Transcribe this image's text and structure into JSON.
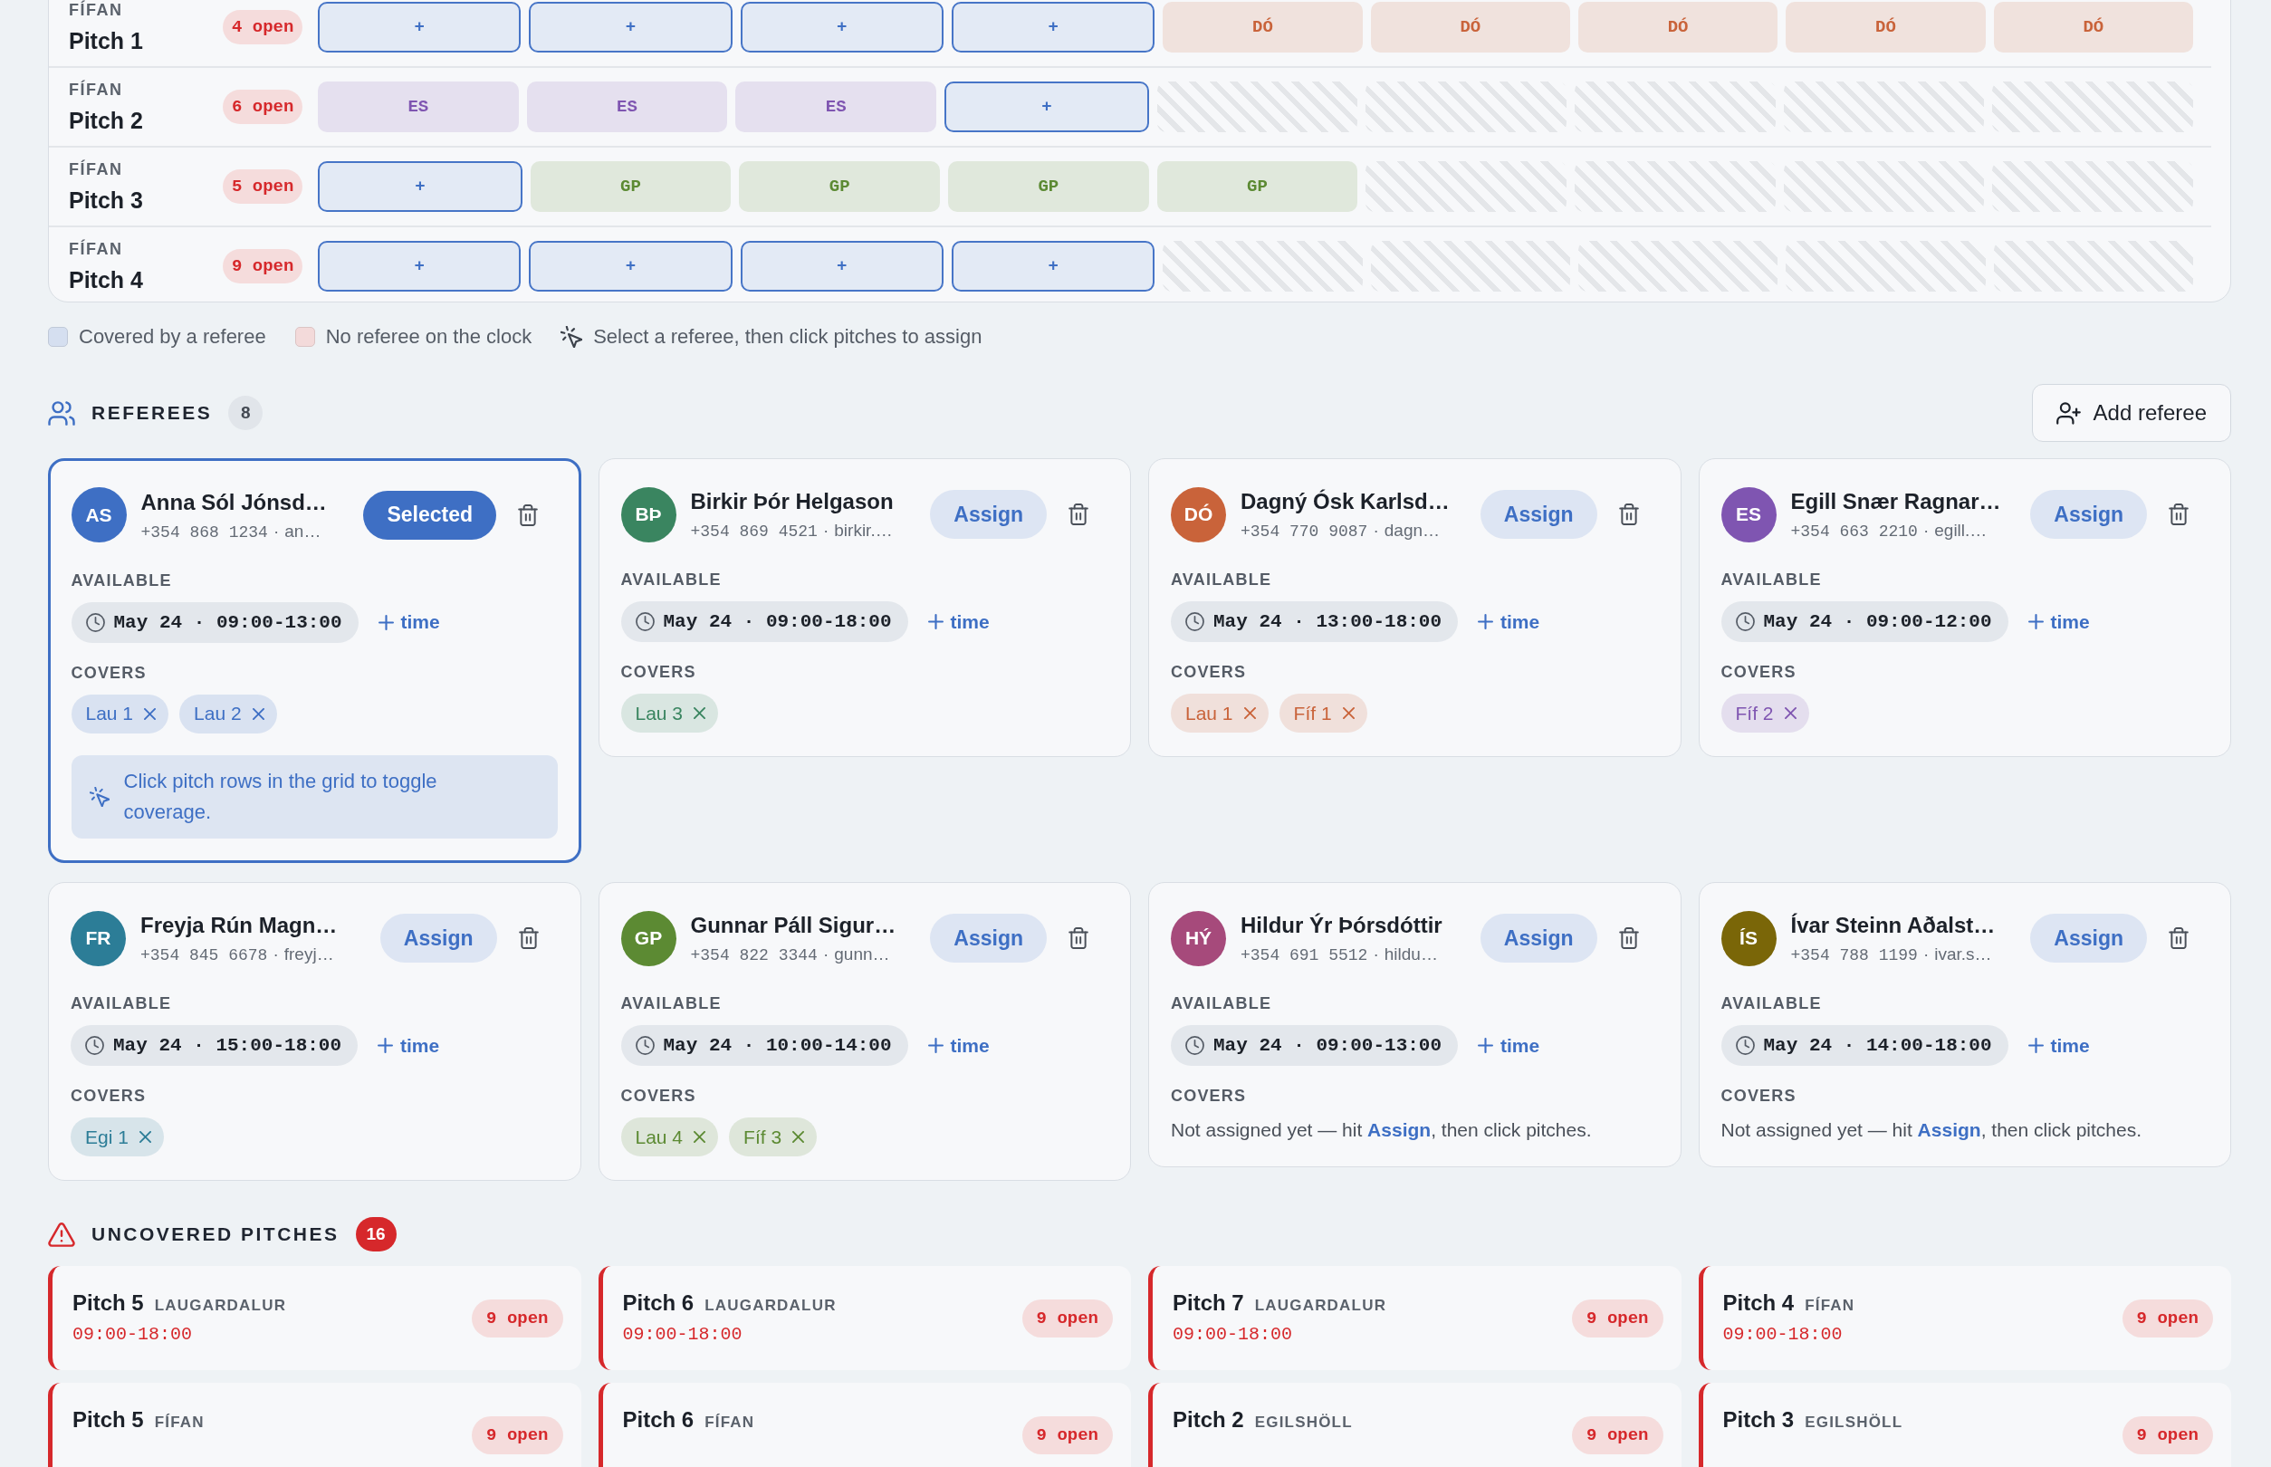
{
  "schedule_grid": {
    "rows": [
      {
        "venue": "FÍFAN",
        "pitch": "Pitch 1",
        "open": "4 open",
        "slots": [
          {
            "kind": "open",
            "label": "+"
          },
          {
            "kind": "open",
            "label": "+"
          },
          {
            "kind": "open",
            "label": "+"
          },
          {
            "kind": "open",
            "label": "+"
          },
          {
            "kind": "covered",
            "label": "DÓ",
            "color": "#c9633a"
          },
          {
            "kind": "covered",
            "label": "DÓ",
            "color": "#c9633a"
          },
          {
            "kind": "covered",
            "label": "DÓ",
            "color": "#c9633a"
          },
          {
            "kind": "covered",
            "label": "DÓ",
            "color": "#c9633a"
          },
          {
            "kind": "covered",
            "label": "DÓ",
            "color": "#c9633a"
          }
        ]
      },
      {
        "venue": "FÍFAN",
        "pitch": "Pitch 2",
        "open": "6 open",
        "slots": [
          {
            "kind": "covered",
            "label": "ES",
            "color": "#7f55b1"
          },
          {
            "kind": "covered",
            "label": "ES",
            "color": "#7f55b1"
          },
          {
            "kind": "covered",
            "label": "ES",
            "color": "#7f55b1"
          },
          {
            "kind": "open",
            "label": "+"
          },
          {
            "kind": "off"
          },
          {
            "kind": "off"
          },
          {
            "kind": "off"
          },
          {
            "kind": "off"
          },
          {
            "kind": "off"
          }
        ]
      },
      {
        "venue": "FÍFAN",
        "pitch": "Pitch 3",
        "open": "5 open",
        "slots": [
          {
            "kind": "open",
            "label": "+"
          },
          {
            "kind": "covered",
            "label": "GP",
            "color": "#5c8a33"
          },
          {
            "kind": "covered",
            "label": "GP",
            "color": "#5c8a33"
          },
          {
            "kind": "covered",
            "label": "GP",
            "color": "#5c8a33"
          },
          {
            "kind": "covered",
            "label": "GP",
            "color": "#5c8a33"
          },
          {
            "kind": "off"
          },
          {
            "kind": "off"
          },
          {
            "kind": "off"
          },
          {
            "kind": "off"
          }
        ]
      },
      {
        "venue": "FÍFAN",
        "pitch": "Pitch 4",
        "open": "9 open",
        "slots": [
          {
            "kind": "open",
            "label": "+"
          },
          {
            "kind": "open",
            "label": "+"
          },
          {
            "kind": "open",
            "label": "+"
          },
          {
            "kind": "open",
            "label": "+"
          },
          {
            "kind": "off"
          },
          {
            "kind": "off"
          },
          {
            "kind": "off"
          },
          {
            "kind": "off"
          },
          {
            "kind": "off"
          }
        ]
      }
    ]
  },
  "legend": [
    {
      "kind": "swatch",
      "color": "#d5dff0",
      "label": "Covered by a referee"
    },
    {
      "kind": "swatch",
      "color": "#f3dada",
      "label": "No referee on the clock"
    },
    {
      "kind": "tip",
      "label": "Select a referee, then click pitches to assign"
    }
  ],
  "referees": {
    "title": "REFEREES",
    "count": "8",
    "add_button": "Add referee",
    "items": [
      {
        "initials": "AS",
        "name": "Anna Sól Jónsd…",
        "phone": "+354 868 1234",
        "sep": "·",
        "email": "an…",
        "color": "#3e6fc4",
        "selected": true,
        "action": "Selected",
        "available_label": "AVAILABLE",
        "times": [
          "May 24 · 09:00-13:00"
        ],
        "add_time": "time",
        "covers_label": "COVERS",
        "covers": [
          "Lau 1",
          "Lau 2"
        ],
        "hint": "Click pitch rows in the grid to toggle coverage."
      },
      {
        "initials": "BÞ",
        "name": "Birkir Þór Helgason",
        "phone": "+354 869 4521",
        "sep": "·",
        "email": "birkir.…",
        "color": "#3a8560",
        "selected": false,
        "action": "Assign",
        "available_label": "AVAILABLE",
        "times": [
          "May 24 · 09:00-18:00"
        ],
        "add_time": "time",
        "covers_label": "COVERS",
        "covers": [
          "Lau 3"
        ]
      },
      {
        "initials": "DÓ",
        "name": "Dagný Ósk Karlsd…",
        "phone": "+354 770 9087",
        "sep": "·",
        "email": "dagn…",
        "color": "#c9633a",
        "selected": false,
        "action": "Assign",
        "available_label": "AVAILABLE",
        "times": [
          "May 24 · 13:00-18:00"
        ],
        "add_time": "time",
        "covers_label": "COVERS",
        "covers": [
          "Lau 1",
          "Fíf 1"
        ]
      },
      {
        "initials": "ES",
        "name": "Egill Snær Ragnar…",
        "phone": "+354 663 2210",
        "sep": "·",
        "email": "egill.…",
        "color": "#7f55b1",
        "selected": false,
        "action": "Assign",
        "available_label": "AVAILABLE",
        "times": [
          "May 24 · 09:00-12:00"
        ],
        "add_time": "time",
        "covers_label": "COVERS",
        "covers": [
          "Fíf 2"
        ]
      },
      {
        "initials": "FR",
        "name": "Freyja Rún Magn…",
        "phone": "+354 845 6678",
        "sep": "·",
        "email": "freyj…",
        "color": "#2c7d97",
        "selected": false,
        "action": "Assign",
        "available_label": "AVAILABLE",
        "times": [
          "May 24 · 15:00-18:00"
        ],
        "add_time": "time",
        "covers_label": "COVERS",
        "covers": [
          "Egi 1"
        ]
      },
      {
        "initials": "GP",
        "name": "Gunnar Páll Sigur…",
        "phone": "+354 822 3344",
        "sep": "·",
        "email": "gunn…",
        "color": "#5c8a33",
        "selected": false,
        "action": "Assign",
        "available_label": "AVAILABLE",
        "times": [
          "May 24 · 10:00-14:00"
        ],
        "add_time": "time",
        "covers_label": "COVERS",
        "covers": [
          "Lau 4",
          "Fíf 3"
        ]
      },
      {
        "initials": "HÝ",
        "name": "Hildur Ýr Þórsdóttir",
        "phone": "+354 691 5512",
        "sep": "·",
        "email": "hildu…",
        "color": "#a64a7b",
        "selected": false,
        "action": "Assign",
        "available_label": "AVAILABLE",
        "times": [
          "May 24 · 09:00-13:00"
        ],
        "add_time": "time",
        "covers_label": "COVERS",
        "empty_note": "Not assigned yet — hit **Assign**, then click pitches."
      },
      {
        "initials": "ÍS",
        "name": "Ívar Steinn Aðalst…",
        "phone": "+354 788 1199",
        "sep": "·",
        "email": "ivar.s…",
        "color": "#7a6608",
        "selected": false,
        "action": "Assign",
        "available_label": "AVAILABLE",
        "times": [
          "May 24 · 14:00-18:00"
        ],
        "add_time": "time",
        "covers_label": "COVERS",
        "empty_note": "Not assigned yet — hit **Assign**, then click pitches."
      }
    ]
  },
  "uncovered": {
    "title": "UNCOVERED PITCHES",
    "count": "16",
    "items": [
      {
        "pitch": "Pitch 5",
        "venue": "LAUGARDALUR",
        "time": "09:00-18:00",
        "open": "9 open"
      },
      {
        "pitch": "Pitch 6",
        "venue": "LAUGARDALUR",
        "time": "09:00-18:00",
        "open": "9 open"
      },
      {
        "pitch": "Pitch 7",
        "venue": "LAUGARDALUR",
        "time": "09:00-18:00",
        "open": "9 open"
      },
      {
        "pitch": "Pitch 4",
        "venue": "FÍFAN",
        "time": "09:00-18:00",
        "open": "9 open"
      },
      {
        "pitch": "Pitch 5",
        "venue": "FÍFAN",
        "open": "9 open"
      },
      {
        "pitch": "Pitch 6",
        "venue": "FÍFAN",
        "open": "9 open"
      },
      {
        "pitch": "Pitch 2",
        "venue": "EGILSHÖLL",
        "open": "9 open"
      },
      {
        "pitch": "Pitch 3",
        "venue": "EGILSHÖLL",
        "open": "9 open"
      }
    ]
  }
}
